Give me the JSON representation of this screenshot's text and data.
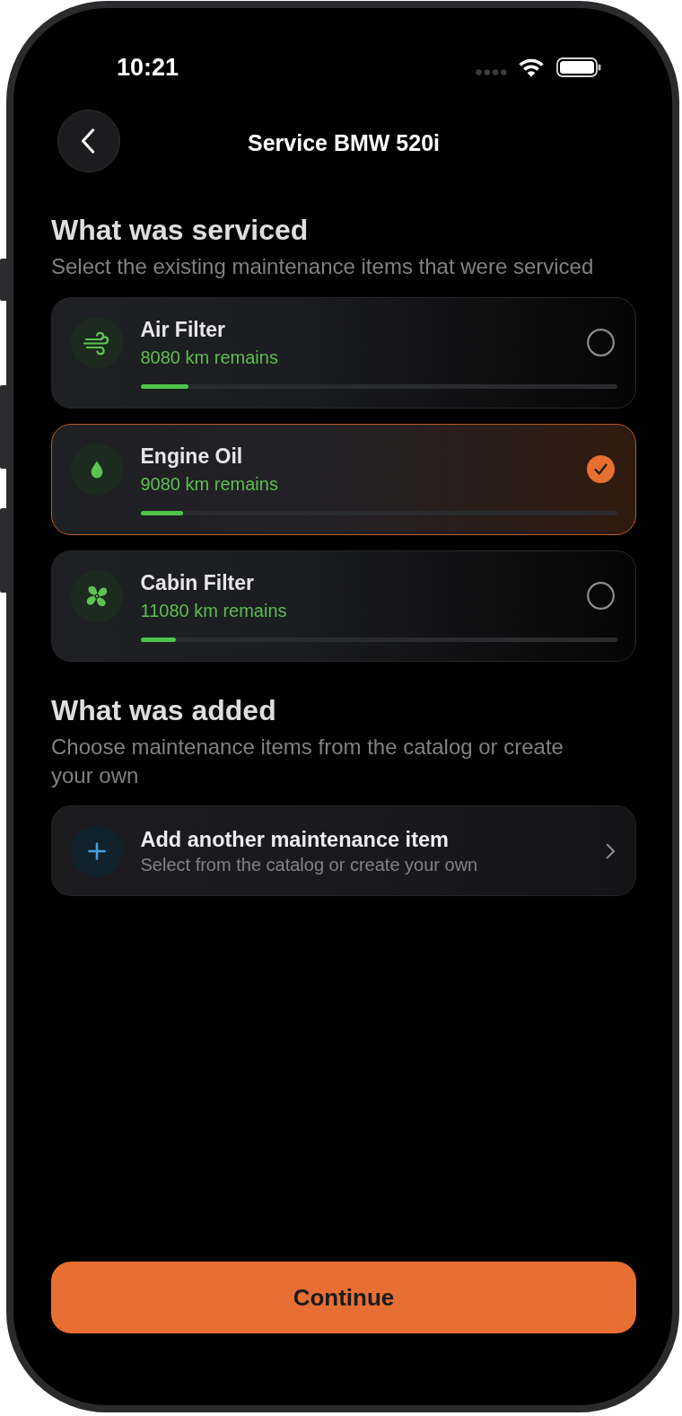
{
  "status_bar": {
    "time": "10:21"
  },
  "header": {
    "title": "Service BMW 520i"
  },
  "serviced": {
    "heading": "What was serviced",
    "subtitle": "Select the existing maintenance items that were serviced",
    "items": [
      {
        "kind": "air",
        "name": "Air Filter",
        "remaining": "8080 km remains",
        "level": 0.1,
        "selected": false
      },
      {
        "kind": "oil",
        "name": "Engine Oil",
        "remaining": "9080 km remains",
        "level": 0.09,
        "selected": true
      },
      {
        "kind": "cabin",
        "name": "Cabin Filter",
        "remaining": "11080 km remains",
        "level": 0.075,
        "selected": false
      }
    ]
  },
  "added": {
    "heading": "What was added",
    "subtitle": "Choose maintenance items from the catalog or create your own",
    "add_item": {
      "title": "Add another maintenance item",
      "subtitle": "Select from the catalog or create your own"
    }
  },
  "continue_button": {
    "label": "Continue"
  }
}
